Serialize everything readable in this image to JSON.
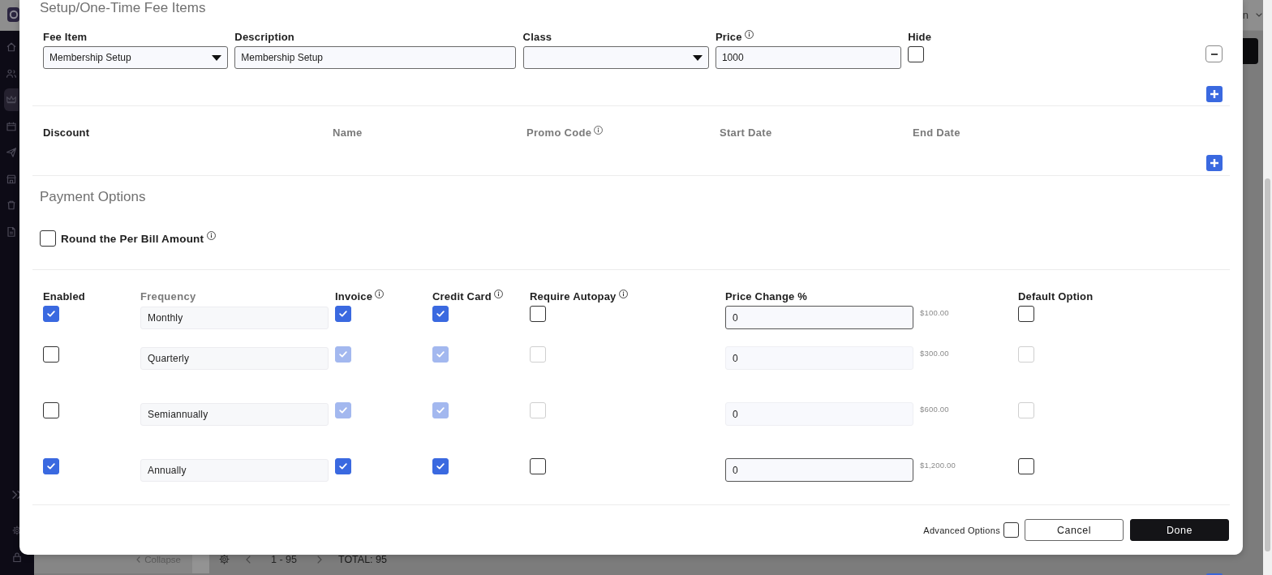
{
  "background": {
    "header": {
      "menu_text": "n"
    },
    "sidebar": {
      "items": [
        {
          "selected": false
        },
        {
          "selected": false
        },
        {
          "selected": true
        },
        {
          "selected": false
        },
        {
          "selected": false
        },
        {
          "selected": false
        },
        {
          "selected": false
        },
        {
          "selected": false
        }
      ]
    },
    "footer": {
      "collapse": "Collapse",
      "range": "1 - 95",
      "total": "TOTAL: 95"
    }
  },
  "fee_items": {
    "title": "Setup/One-Time Fee Items",
    "rows": [
      {
        "fields": [
          {
            "label": "Fee Item",
            "kind": "dropdown",
            "info": false,
            "value": "Membership Setup"
          },
          {
            "label": "Description",
            "kind": "text",
            "info": false,
            "value": "Membership Setup"
          },
          {
            "label": "Class",
            "kind": "dropdown",
            "info": false
          },
          {
            "label": "Price",
            "kind": "text",
            "info": true,
            "value": "1000"
          },
          {
            "label": "Hide",
            "kind": "checkbox",
            "info": false,
            "checked": false
          }
        ]
      }
    ]
  },
  "discounts": {
    "columns": [
      {
        "label": "Discount",
        "kind": "heading",
        "info": false
      },
      {
        "label": "Name",
        "kind": "muted",
        "info": false
      },
      {
        "label": "Promo Code",
        "kind": "muted",
        "info": true
      },
      {
        "label": "Start Date",
        "kind": "muted",
        "info": false
      },
      {
        "label": "End Date",
        "kind": "muted",
        "info": false
      }
    ]
  },
  "payment_options": {
    "title": "Payment Options",
    "round_per_bill": {
      "label": "Round the Per Bill Amount",
      "checked": false,
      "info": true
    },
    "columns": [
      {
        "label": "Enabled",
        "kind": "heading",
        "info": false
      },
      {
        "label": "Frequency",
        "kind": "muted",
        "info": false
      },
      {
        "label": "Invoice",
        "kind": "heading",
        "info": true
      },
      {
        "label": "Credit Card",
        "kind": "heading",
        "info": true
      },
      {
        "label": "Require Autopay",
        "kind": "heading",
        "info": true
      },
      {
        "label": "Price Change %",
        "kind": "heading",
        "info": false
      },
      {
        "label": "Default Option",
        "kind": "heading",
        "info": false
      }
    ],
    "rows": [
      {
        "enabled": true,
        "frequency": "Monthly",
        "invoice": true,
        "credit_card": true,
        "require_autopay": false,
        "price_change": "0",
        "amount": "$100.00",
        "default_option": false
      },
      {
        "enabled": false,
        "frequency": "Quarterly",
        "invoice": true,
        "credit_card": true,
        "require_autopay": false,
        "price_change": "0",
        "amount": "$300.00",
        "default_option": false
      },
      {
        "enabled": false,
        "frequency": "Semiannually",
        "invoice": true,
        "credit_card": true,
        "require_autopay": false,
        "price_change": "0",
        "amount": "$600.00",
        "default_option": false
      },
      {
        "enabled": true,
        "frequency": "Annually",
        "invoice": true,
        "credit_card": true,
        "require_autopay": false,
        "price_change": "0",
        "amount": "$1,200.00",
        "default_option": false
      }
    ]
  },
  "footer": {
    "advanced_options": {
      "label": "Advanced Options",
      "checked": false
    },
    "buttons": [
      {
        "label": "Cancel",
        "kind": "secondary"
      },
      {
        "label": "Done",
        "kind": "primary"
      }
    ]
  }
}
